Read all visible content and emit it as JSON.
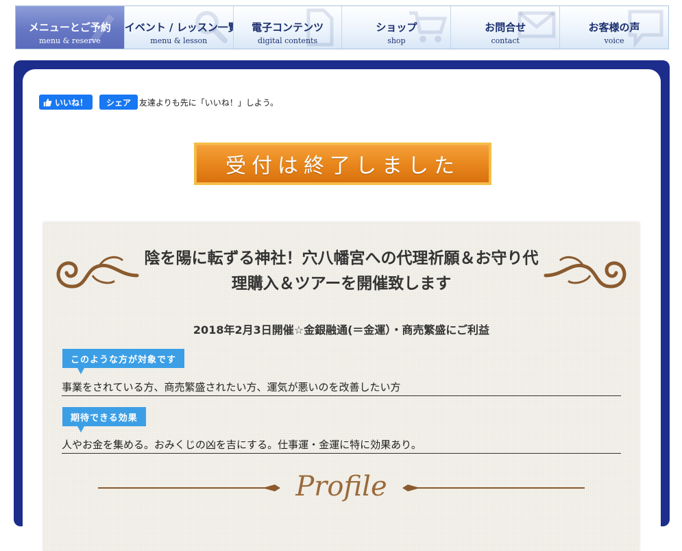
{
  "nav": {
    "items": [
      {
        "jp": "メニューとご予約",
        "en": "menu & reserve",
        "active": true
      },
      {
        "jp": "イベント / レッスン一覧",
        "en": "menu & lesson",
        "active": false
      },
      {
        "jp": "電子コンテンツ",
        "en": "digital contents",
        "active": false
      },
      {
        "jp": "ショップ",
        "en": "shop",
        "active": false
      },
      {
        "jp": "お問合せ",
        "en": "contact",
        "active": false
      },
      {
        "jp": "お客様の声",
        "en": "voice",
        "active": false
      }
    ]
  },
  "facebook": {
    "like_label": "いいね！",
    "share_label": "シェア",
    "prompt": "友達よりも先に「いいね！」しよう。"
  },
  "closed_button": {
    "label": "受付は終了しました"
  },
  "card": {
    "title": "陰を陽に転ずる神社！穴八幡宮への代理祈願＆お守り代理購入＆ツアーを開催致します",
    "subtitle": "2018年2月3日開催☆金銀融通(＝金運）・商売繁盛にご利益",
    "target_tag": "このような方が対象です",
    "target_text": "事業をされている方、商売繁盛されたい方、運気が悪いのを改善したい方",
    "effect_tag": "期待できる効果",
    "effect_text": "人やお金を集める。おみくじの凶を吉にする。仕事運・金運に特に効果あり。",
    "profile_heading": "Profile"
  },
  "colors": {
    "nav_text": "#1b2f6e",
    "nav_active": "#6677c4",
    "frame": "#1c2d8c",
    "button_orange": "#ea8a1f",
    "tag_blue": "#3c9fe6",
    "flourish_brown": "#8a5a2e"
  }
}
